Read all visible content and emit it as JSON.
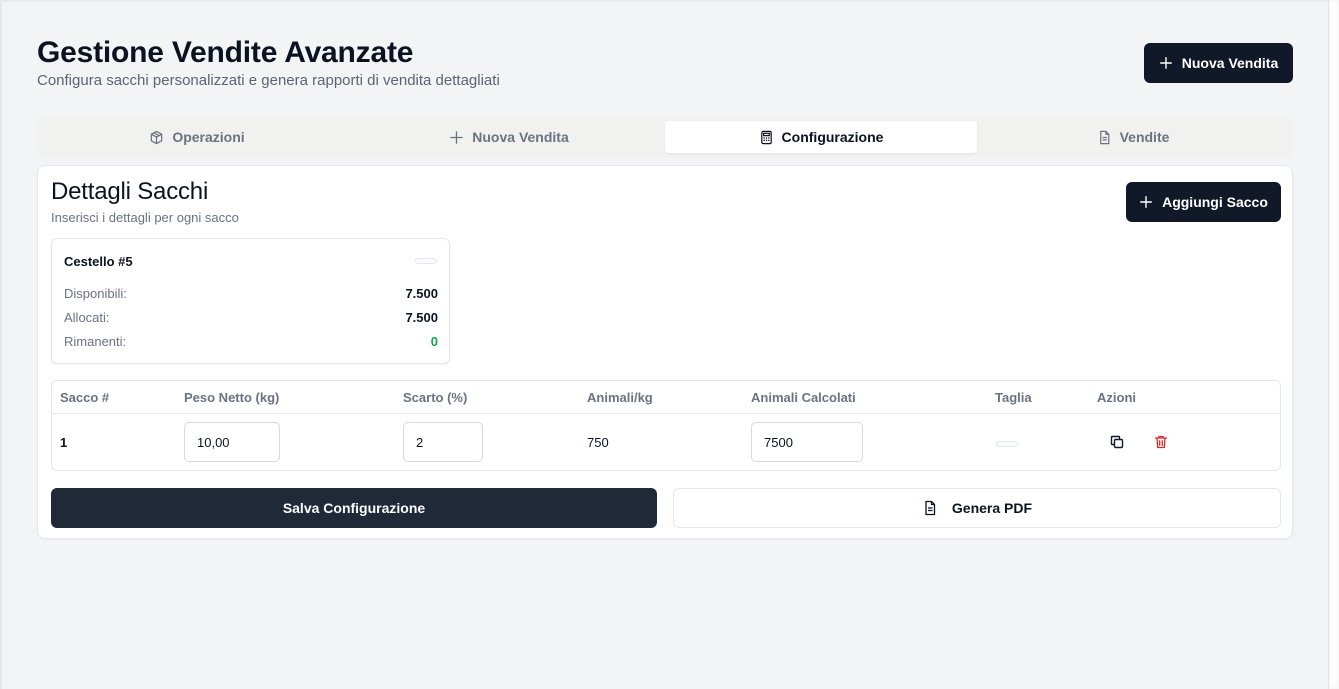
{
  "header": {
    "title": "Gestione Vendite Avanzate",
    "subtitle": "Configura sacchi personalizzati e genera rapporti di vendita dettagliati",
    "new_sale_label": "Nuova Vendita"
  },
  "tabs": [
    {
      "label": "Operazioni",
      "icon": "box-icon"
    },
    {
      "label": "Nuova Vendita",
      "icon": "plus-icon"
    },
    {
      "label": "Configurazione",
      "icon": "calculator-icon",
      "active": true
    },
    {
      "label": "Vendite",
      "icon": "document-icon"
    }
  ],
  "card": {
    "title": "Dettagli Sacchi",
    "subtitle": "Inserisci i dettagli per ogni sacco",
    "add_label": "Aggiungi Sacco"
  },
  "summary": {
    "name": "Cestello #5",
    "rows": [
      {
        "label": "Disponibili:",
        "value": "7.500"
      },
      {
        "label": "Allocati:",
        "value": "7.500"
      },
      {
        "label": "Rimanenti:",
        "value": "0"
      }
    ]
  },
  "table": {
    "headers": [
      "Sacco #",
      "Peso Netto (kg)",
      "Scarto (%)",
      "Animali/kg",
      "Animali Calcolati",
      "Taglia",
      "Azioni"
    ],
    "rows": [
      {
        "sacco": "1",
        "peso": "10,00",
        "scarto": "2",
        "animali_kg": "750",
        "animali_calcolati": "7500",
        "taglia": ""
      }
    ]
  },
  "actions": {
    "save_label": "Salva Configurazione",
    "pdf_label": "Genera PDF"
  },
  "colors": {
    "primary": "#111827",
    "positive": "#16a34a",
    "danger": "#dc2626"
  }
}
